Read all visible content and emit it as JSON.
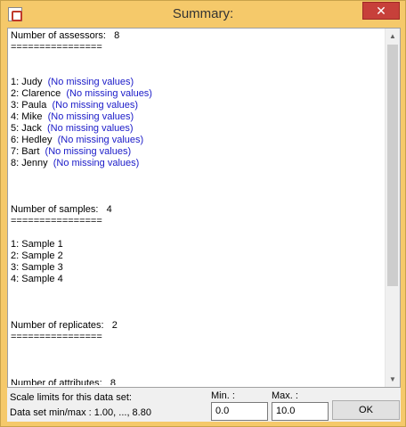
{
  "window": {
    "title": "Summary:",
    "close_label": "✕"
  },
  "summary": {
    "assessors_header": "Number of assessors:   8",
    "separator": "================",
    "assessors": [
      {
        "label": "1: Judy",
        "note": "(No missing values)"
      },
      {
        "label": "2: Clarence",
        "note": "(No missing values)"
      },
      {
        "label": "3: Paula",
        "note": "(No missing values)"
      },
      {
        "label": "4: Mike",
        "note": "(No missing values)"
      },
      {
        "label": "5: Jack",
        "note": "(No missing values)"
      },
      {
        "label": "6: Hedley",
        "note": "(No missing values)"
      },
      {
        "label": "7: Bart",
        "note": "(No missing values)"
      },
      {
        "label": "8: Jenny",
        "note": "(No missing values)"
      }
    ],
    "samples_header": "Number of samples:   4",
    "samples": [
      "1: Sample 1",
      "2: Sample 2",
      "3: Sample 3",
      "4: Sample 4"
    ],
    "replicates_header": "Number of replicates:   2",
    "attributes_header": "Number of attributes:   8"
  },
  "footer": {
    "scale_label": "Scale limits for this data set:",
    "minmax_label": "Data set min/max :  1.00, ..., 8.80",
    "min_header": "Min. :",
    "max_header": "Max. :",
    "min_value": "0.0",
    "max_value": "10.0",
    "ok_label": "OK"
  }
}
